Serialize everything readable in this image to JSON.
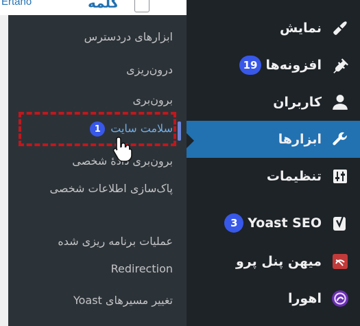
{
  "page": {
    "link_text": "Ertano",
    "column_word": "کلمه"
  },
  "sidebar": {
    "items": [
      {
        "label": "نمایش",
        "icon": "paintbrush-icon"
      },
      {
        "label": "افزونه‌ها",
        "badge": "19",
        "icon": "plugin-icon"
      },
      {
        "label": "کاربران",
        "icon": "user-icon"
      },
      {
        "label": "ابزارها",
        "icon": "wrench-icon",
        "active": true
      },
      {
        "label": "تنظیمات",
        "icon": "settings-sliders-icon"
      },
      {
        "label": "Yoast SEO",
        "badge": "3",
        "icon": "yoast-icon"
      },
      {
        "label": "میهن پنل پرو",
        "icon": "mihanpanel-icon"
      },
      {
        "label": "اهورا",
        "icon": "ahura-icon"
      }
    ]
  },
  "submenu": {
    "items": [
      {
        "label": "ابزارهای دردسترس"
      },
      {
        "label": "درون‌ریزی"
      },
      {
        "label": "برون‌بری"
      },
      {
        "label": "سلامت سایت",
        "badge": "1",
        "current": true
      },
      {
        "label": "برون‌بری دادهٔ شخصی"
      },
      {
        "label": "پاک‌سازی اطلاعات شخصی"
      },
      {
        "label": "عملیات برنامه ریزی شده"
      },
      {
        "label": "Redirection"
      },
      {
        "label": "تغییر مسیرهای Yoast"
      }
    ]
  },
  "colors": {
    "sidebar_bg": "#1d2327",
    "submenu_bg": "#2c3338",
    "active_bg": "#2271b1",
    "badge_bg": "#3858e9",
    "highlight": "#c0171d"
  }
}
